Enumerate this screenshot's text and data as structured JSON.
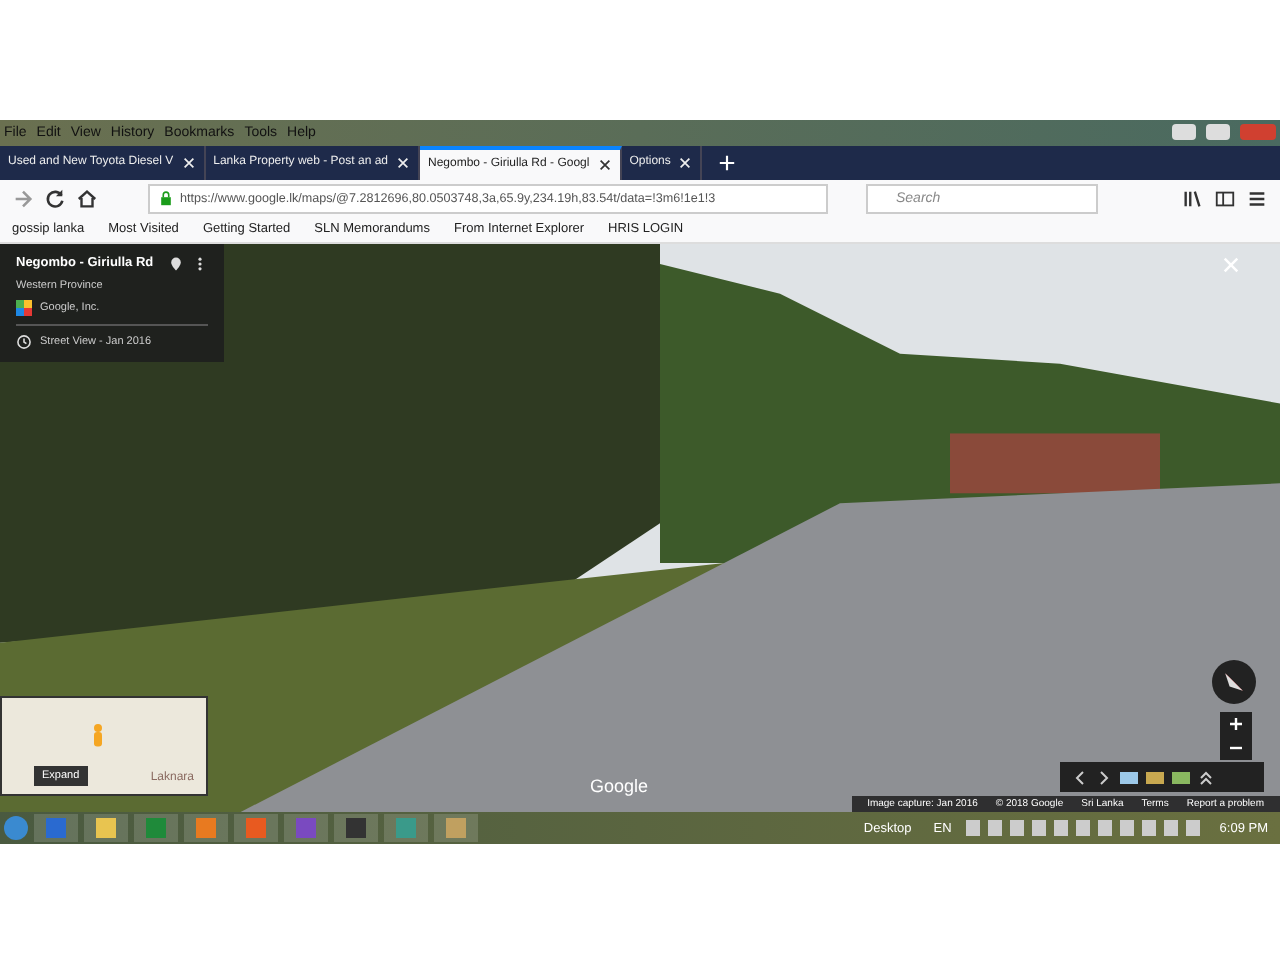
{
  "menu": [
    "File",
    "Edit",
    "View",
    "History",
    "Bookmarks",
    "Tools",
    "Help"
  ],
  "tabs": [
    {
      "label": "Used and New Toyota Diesel V",
      "selected": false
    },
    {
      "label": "Lanka Property web - Post an ad",
      "selected": false
    },
    {
      "label": "Negombo - Giriulla Rd - Googl",
      "selected": true
    },
    {
      "label": "Options",
      "selected": false
    }
  ],
  "address_bar": {
    "url": "https://www.google.lk/maps/@7.2812696,80.0503748,3a,65.9y,234.19h,83.54t/data=!3m6!1e1!3"
  },
  "search": {
    "placeholder": "Search"
  },
  "bookmarks": [
    "gossip lanka",
    "Most Visited",
    "Getting Started",
    "SLN Memorandums",
    "From Internet Explorer",
    "HRIS LOGIN"
  ],
  "street_view": {
    "title": "Negombo - Giriulla Rd",
    "subtitle": "Western Province",
    "author": "Google, Inc.",
    "date": "Street View - Jan 2016",
    "map_place": "Laknara",
    "expand": "Expand",
    "logo": "Google",
    "footer": [
      "Image capture: Jan 2016",
      "© 2018 Google",
      "Sri Lanka",
      "Terms",
      "Report a problem"
    ]
  },
  "taskbar": {
    "desktop": "Desktop",
    "language": "EN",
    "time": "6:09 PM"
  }
}
